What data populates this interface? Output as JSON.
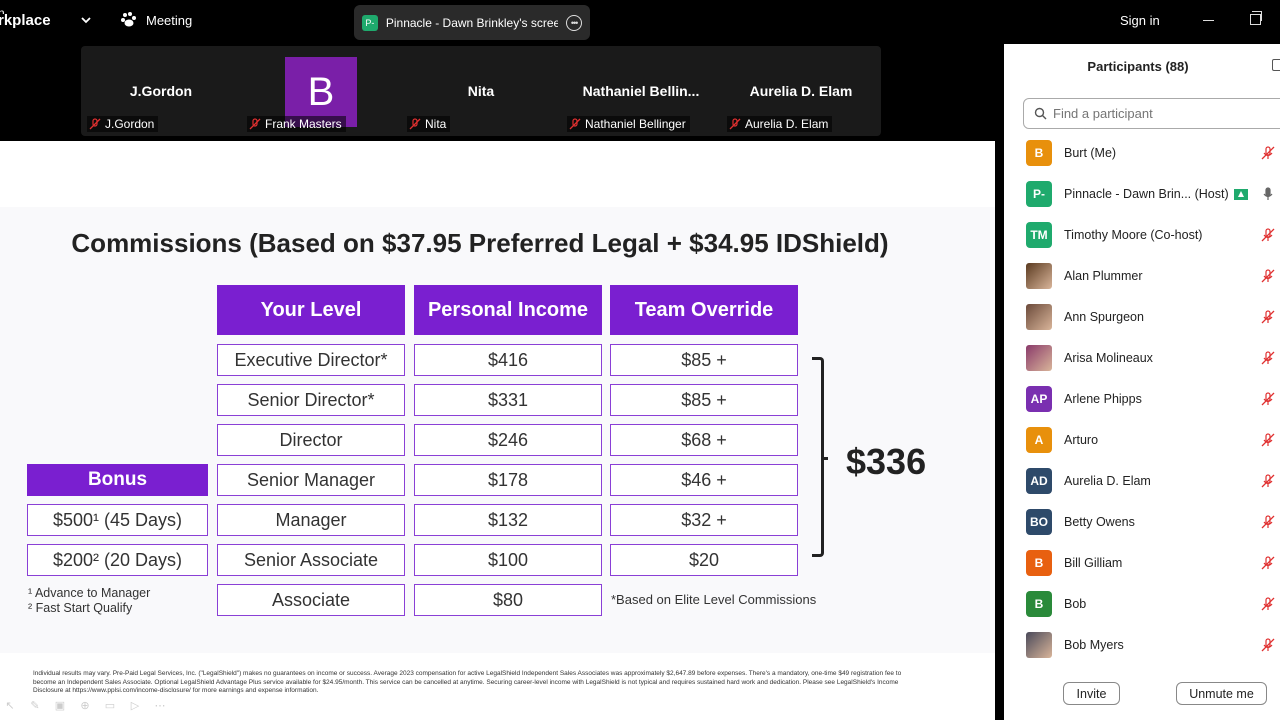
{
  "app": {
    "logo_line1": "n",
    "logo_line2": "rkplace"
  },
  "topbar": {
    "meeting_label": "Meeting",
    "share_avatar": "P-",
    "share_title": "Pinnacle - Dawn Brinkley's screen",
    "sign_in": "Sign in"
  },
  "video_strip": [
    {
      "display": "J.Gordon",
      "label": "J.Gordon"
    },
    {
      "display": "B",
      "label": "Frank Masters"
    },
    {
      "display": "Nita",
      "label": "Nita"
    },
    {
      "display": "Nathaniel  Bellin...",
      "label": "Nathaniel Bellinger"
    },
    {
      "display": "Aurelia D. Elam",
      "label": "Aurelia D. Elam"
    }
  ],
  "slide": {
    "title": "Commissions (Based on $37.95 Preferred Legal + $34.95 IDShield)",
    "headers": {
      "level": "Your Level",
      "personal": "Personal Income",
      "override": "Team Override"
    },
    "rows": [
      {
        "level": "Executive Director*",
        "personal": "$416",
        "override": "$85 +"
      },
      {
        "level": "Senior Director*",
        "personal": "$331",
        "override": "$85 +"
      },
      {
        "level": "Director",
        "personal": "$246",
        "override": "$68 +"
      },
      {
        "level": "Senior Manager",
        "personal": "$178",
        "override": "$46 +"
      },
      {
        "level": "Manager",
        "personal": "$132",
        "override": "$32 +"
      },
      {
        "level": "Senior Associate",
        "personal": "$100",
        "override": "$20"
      },
      {
        "level": "Associate",
        "personal": "$80",
        "override": ""
      }
    ],
    "bonus": {
      "header": "Bonus",
      "items": [
        "$500¹ (45 Days)",
        "$200² (20 Days)"
      ],
      "footnotes": [
        "¹ Advance to Manager",
        "² Fast Start Qualify"
      ]
    },
    "total": "$336",
    "based_note": "*Based on Elite Level Commissions",
    "disclaimer": "Individual results may vary. Pre-Paid Legal Services, Inc. (\"LegalShield\") makes no guarantees on income or success. Average 2023 compensation for active LegalShield Independent Sales Associates was approximately $2,647.89 before expenses. There's a mandatory, one-time $49 registration fee to become an Independent Sales Associate. Optional LegalShield Advantage Plus service available for $24.95/month. This service can be cancelled at anytime. Securing career-level income with LegalShield is not typical and requires sustained hard work and dedication. Please see LegalShield's Income Disclosure at https://www.pplsi.com/income-disclosure/ for more earnings and expense information."
  },
  "participants": {
    "title": "Participants (88)",
    "search_placeholder": "Find a participant",
    "list": [
      {
        "initials": "B",
        "name": "Burt (Me)",
        "color": "#e8900c",
        "photo": false
      },
      {
        "initials": "P-",
        "name": "Pinnacle - Dawn Brin... (Host)",
        "color": "#1faa6d",
        "photo": false,
        "host": true
      },
      {
        "initials": "TM",
        "name": "Timothy Moore (Co-host)",
        "color": "#1faa6d",
        "photo": false
      },
      {
        "initials": "",
        "name": "Alan Plummer",
        "color": "#5a3a20",
        "photo": true
      },
      {
        "initials": "",
        "name": "Ann Spurgeon",
        "color": "#6b4a3a",
        "photo": true
      },
      {
        "initials": "",
        "name": "Arisa Molineaux",
        "color": "#8a3a6a",
        "photo": true
      },
      {
        "initials": "AP",
        "name": "Arlene Phipps",
        "color": "#7a2fb0",
        "photo": false
      },
      {
        "initials": "A",
        "name": "Arturo",
        "color": "#e8900c",
        "photo": false
      },
      {
        "initials": "AD",
        "name": "Aurelia D. Elam",
        "color": "#2e4a6a",
        "photo": false
      },
      {
        "initials": "BO",
        "name": "Betty Owens",
        "color": "#2e4a6a",
        "photo": false
      },
      {
        "initials": "B",
        "name": "Bill Gilliam",
        "color": "#e86010",
        "photo": false
      },
      {
        "initials": "B",
        "name": "Bob",
        "color": "#2a8a3a",
        "photo": false
      },
      {
        "initials": "",
        "name": "Bob Myers",
        "color": "#4a4a5a",
        "photo": true
      }
    ],
    "invite": "Invite",
    "unmute": "Unmute me"
  }
}
